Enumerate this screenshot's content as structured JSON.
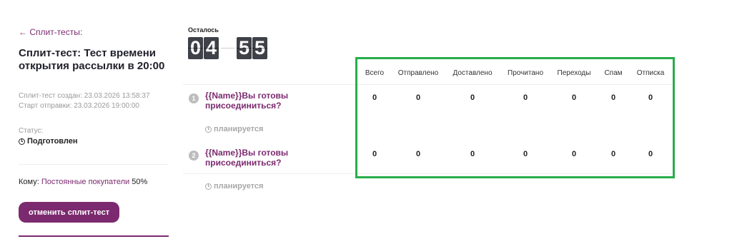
{
  "sidebar": {
    "back_link": "← Сплит-тесты:",
    "title": "Сплит-тест: Тест времени открытия рассылки в 20:00",
    "created": "Сплит-тест создан: 23.03.2026 13:58:37",
    "send_start": "Старт отправки: 23.03.2026 19:00:00",
    "status_label": "Статус:",
    "status_value": "Подготовлен",
    "recipients_label": "Кому:",
    "recipients_segment": "Постоянные покупатели",
    "recipients_percent": "50%",
    "cancel_button": "отменить сплит-тест"
  },
  "timer": {
    "label": "Осталось",
    "hours": [
      "0",
      "4"
    ],
    "minutes": [
      "5",
      "5"
    ]
  },
  "variants": [
    {
      "number": "1",
      "subject": "{{Name}}Вы готовы присоединиться?",
      "status": "планируется"
    },
    {
      "number": "2",
      "subject": "{{Name}}Вы готовы присоединиться?",
      "status": "планируется"
    }
  ],
  "stats": {
    "headers": [
      "Всего",
      "Отправлено",
      "Доставлено",
      "Прочитано",
      "Переходы",
      "Спам",
      "Отписка"
    ],
    "rows": [
      [
        "0",
        "0",
        "0",
        "0",
        "0",
        "0",
        "0"
      ],
      [
        "0",
        "0",
        "0",
        "0",
        "0",
        "0",
        "0"
      ]
    ]
  },
  "colors": {
    "accent": "#7b2a6f",
    "highlight_box": "#27ae4a",
    "timer_digit_bg": "#3f4148",
    "muted_text": "#9a9a9a"
  },
  "icons": {
    "back": "arrow-left-icon",
    "status": "clock-icon",
    "variant_status": "clock-icon"
  }
}
